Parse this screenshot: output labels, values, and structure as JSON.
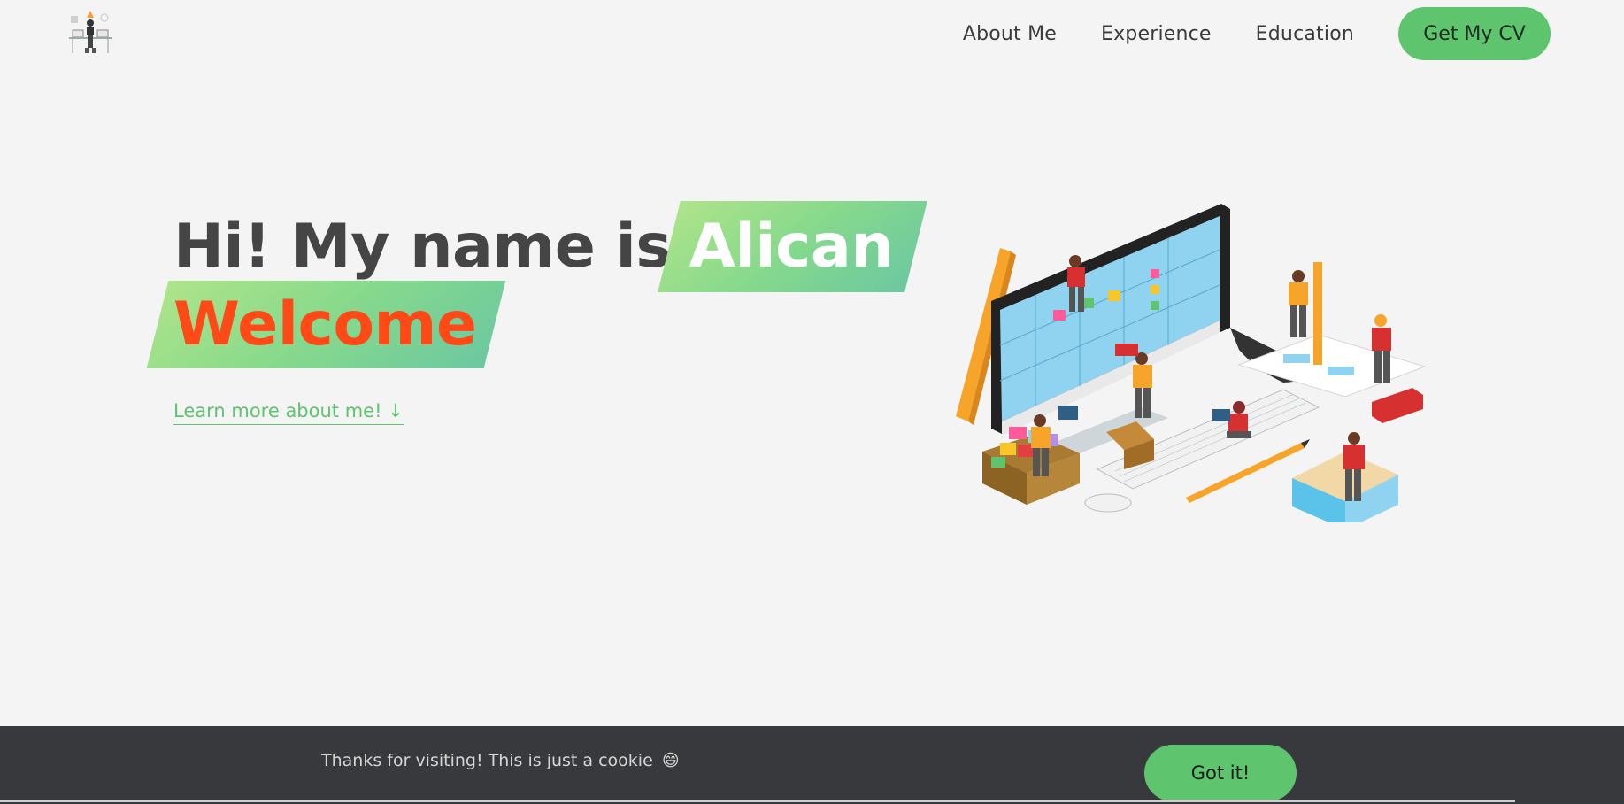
{
  "header": {
    "nav": [
      {
        "label": "About Me"
      },
      {
        "label": "Experience"
      },
      {
        "label": "Education"
      }
    ],
    "cv_button": "Get My CV"
  },
  "hero": {
    "intro": "Hi! My name is",
    "name": "Alican",
    "welcome": "Welcome",
    "learn_more": "Learn more about me! ↓"
  },
  "cookie": {
    "text": "Thanks for visiting! This is just a cookie",
    "emoji": "😄",
    "button": "Got it!"
  },
  "colors": {
    "accent_green": "#5ec46e",
    "welcome_orange": "#ff4a17",
    "highlight_gradient_start": "#aee48a",
    "highlight_gradient_end": "#6cc8a0",
    "cookie_bar": "#38393d",
    "background": "#f4f4f4"
  },
  "icons": {
    "logo": "developer-at-desk-logo",
    "illustration": "isometric-team-building-computer-illustration"
  }
}
